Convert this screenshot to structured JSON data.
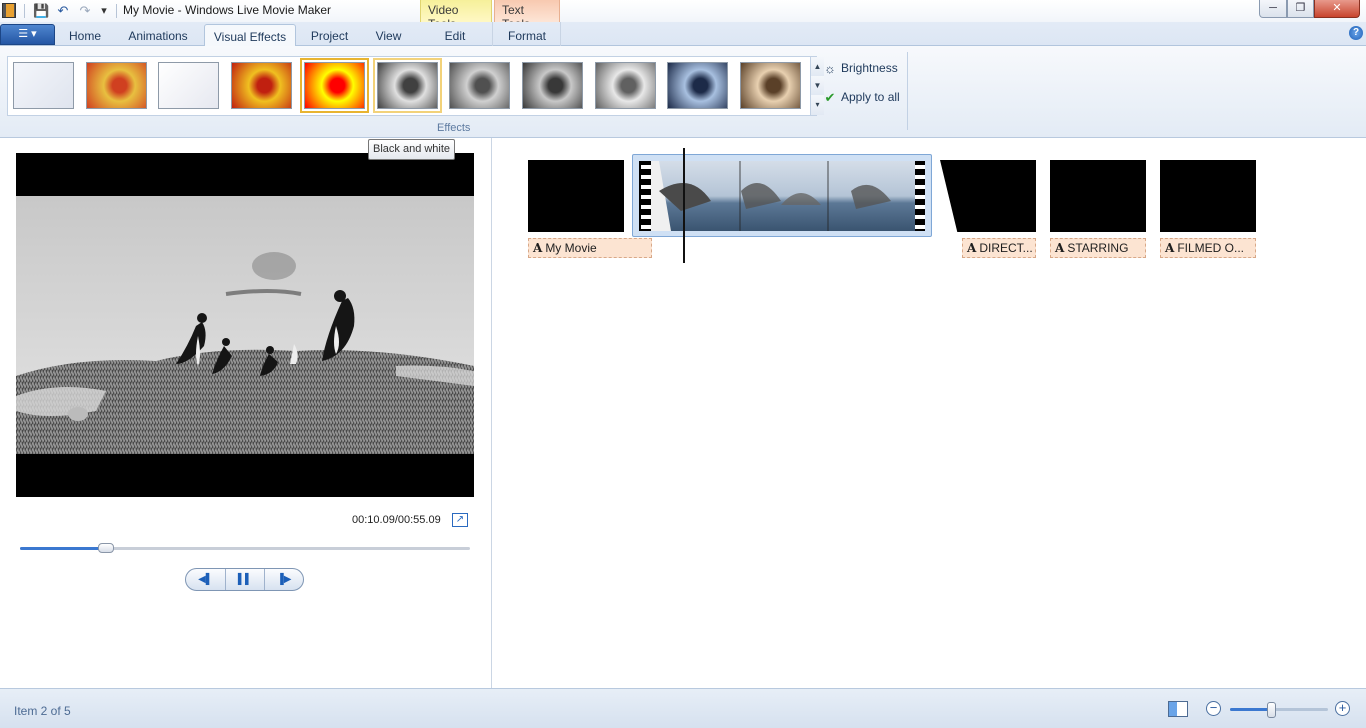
{
  "window": {
    "title": "My Movie - Windows Live Movie Maker",
    "minimize_glyph": "─",
    "maximize_glyph": "❐",
    "close_glyph": "✕"
  },
  "quick_access": {
    "save_icon": "💾",
    "undo_icon": "↶",
    "redo_icon": "↷",
    "customize_icon": "▾"
  },
  "contextual_tabs": {
    "video_tools": "Video Tools",
    "text_tools": "Text Tools"
  },
  "app_menu_glyph": "☰ ▾",
  "tabs": [
    {
      "label": "Home"
    },
    {
      "label": "Animations"
    },
    {
      "label": "Visual Effects",
      "active": true
    },
    {
      "label": "Project"
    },
    {
      "label": "View"
    },
    {
      "label": "Edit"
    },
    {
      "label": "Format"
    }
  ],
  "help_glyph": "?",
  "ribbon": {
    "effects": [
      {
        "name": "no-effect",
        "colors": [
          "#f4f6fb",
          "#dfe4ee"
        ]
      },
      {
        "name": "blur",
        "colors": [
          "#e8c040",
          "#d04020"
        ]
      },
      {
        "name": "edge-detection",
        "colors": [
          "#ffffff",
          "#e6e8f0"
        ]
      },
      {
        "name": "posterize",
        "colors": [
          "#f0c020",
          "#c02010"
        ]
      },
      {
        "name": "threshold",
        "colors": [
          "#ffff00",
          "#ff0000"
        ],
        "selected": true
      },
      {
        "name": "black-and-white",
        "colors": [
          "#e0e0e0",
          "#404040"
        ],
        "hovered": true
      },
      {
        "name": "black-and-white-orange-filter",
        "colors": [
          "#d0d0d0",
          "#505050"
        ]
      },
      {
        "name": "black-and-white-red-filter",
        "colors": [
          "#c8c8c8",
          "#383838"
        ]
      },
      {
        "name": "black-and-white-yellow-filter",
        "colors": [
          "#e8e8e8",
          "#606060"
        ]
      },
      {
        "name": "cyanotype",
        "colors": [
          "#a8c0e0",
          "#1c2a48"
        ]
      },
      {
        "name": "sepia-tone",
        "colors": [
          "#e8d0b0",
          "#5a4028"
        ]
      }
    ],
    "brightness_label": "Brightness",
    "brightness_icon": "☼",
    "apply_all_label": "Apply to all",
    "apply_all_icon": "✔",
    "group_label": "Effects",
    "tooltip": "Black and white",
    "gallery_up": "▲",
    "gallery_down": "▼",
    "gallery_more": "▾"
  },
  "preview": {
    "time": "00:10.09/00:55.09",
    "progress": 0.19,
    "fullscreen_glyph": "↗",
    "prev_frame_glyph": "◀▌",
    "pause_glyph": "▌▌",
    "next_frame_glyph": "▐▶"
  },
  "storyboard": {
    "captions": [
      {
        "label": "My Movie"
      },
      {
        "label": "DIRECT..."
      },
      {
        "label": "STARRING"
      },
      {
        "label": "FILMED O..."
      }
    ]
  },
  "status": {
    "text": "Item 2 of 5",
    "zoom_out_glyph": "−",
    "zoom_in_glyph": "+",
    "zoom_level": 0.42
  },
  "colors": {
    "accent": "#3b78d0",
    "caption_bg": "#fce4d2",
    "clip_selected_bg": "#cfe0f4"
  }
}
